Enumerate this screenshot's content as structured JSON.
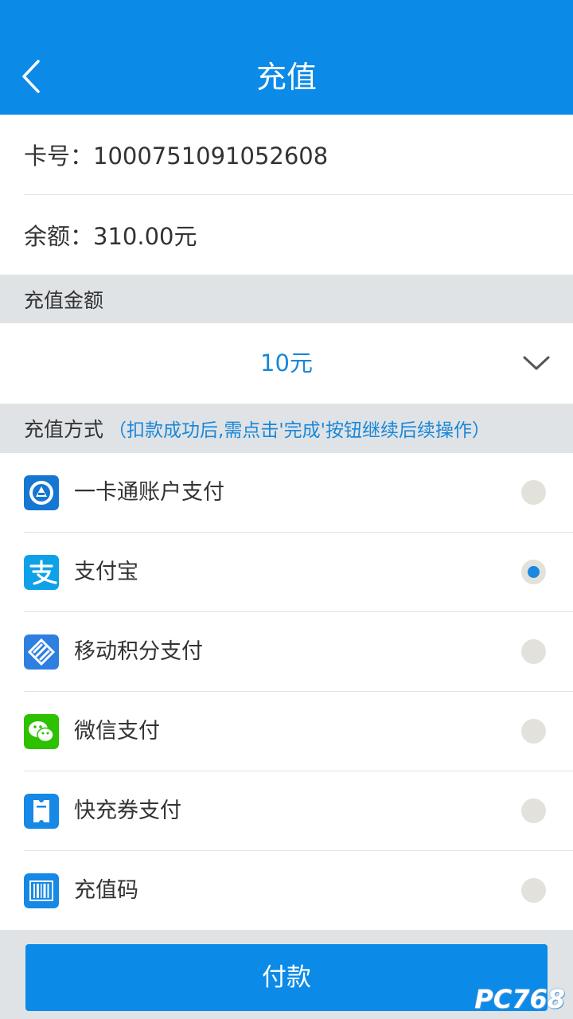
{
  "header": {
    "title": "充值"
  },
  "card": {
    "number_text": "卡号：1000751091052608",
    "balance_text": "余额：310.00元"
  },
  "amount_section": {
    "title": "充值金额",
    "selected_value": "10元"
  },
  "method_section": {
    "title": "充值方式",
    "note": "（扣款成功后,需点击'完成'按钮继续后续操作）"
  },
  "methods": [
    {
      "label": "一卡通账户支付",
      "icon": "card-account-icon",
      "selected": false
    },
    {
      "label": "支付宝",
      "icon": "alipay-icon",
      "selected": true
    },
    {
      "label": "移动积分支付",
      "icon": "china-mobile-icon",
      "selected": false
    },
    {
      "label": "微信支付",
      "icon": "wechat-icon",
      "selected": false
    },
    {
      "label": "快充券支付",
      "icon": "coupon-icon",
      "selected": false
    },
    {
      "label": "充值码",
      "icon": "barcode-icon",
      "selected": false
    }
  ],
  "pay_button": {
    "label": "付款"
  },
  "watermark": {
    "text": "PC768"
  },
  "colors": {
    "accent": "#0b8ae8",
    "link": "#1a87d8",
    "section_bg": "#dfe3e6",
    "wechat": "#2dc100",
    "alipay": "#0fa1e8"
  }
}
